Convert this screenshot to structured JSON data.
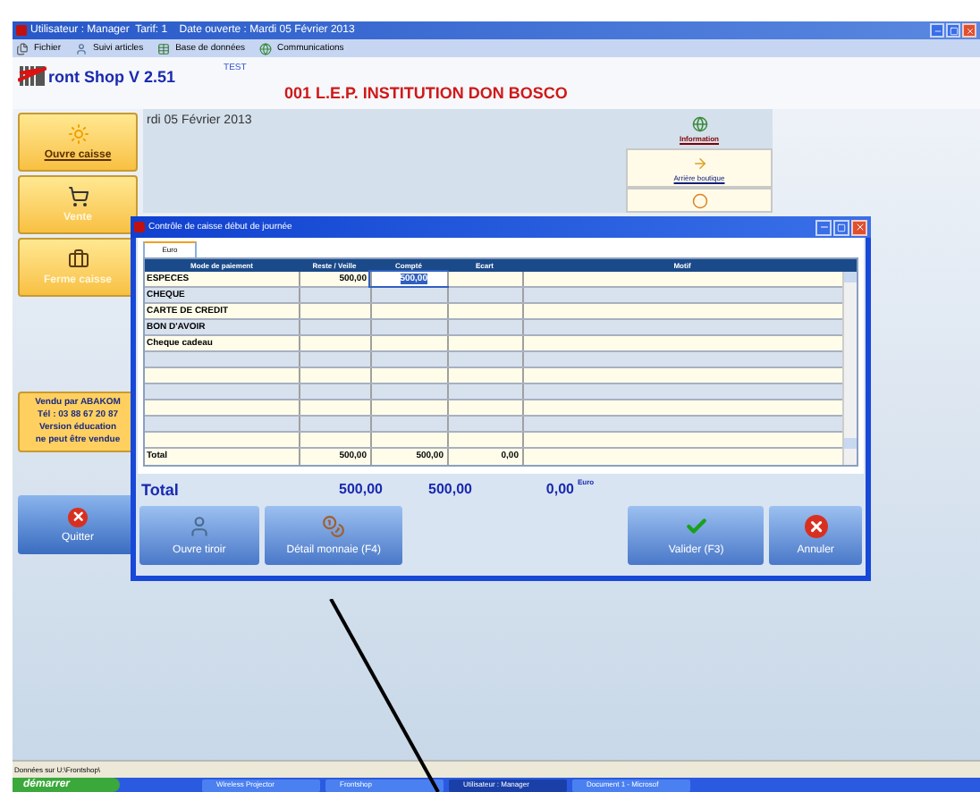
{
  "window": {
    "title": "Utilisateur : Manager  Tarif: 1    Date ouverte : Mardi 05 Février 2013"
  },
  "menu": [
    {
      "label": "Fichier"
    },
    {
      "label": "Suivi articles"
    },
    {
      "label": "Base de données"
    },
    {
      "label": "Communications"
    }
  ],
  "header": {
    "app_name": "ront Shop V 2.51",
    "tag": "TEST",
    "company": "001 L.E.P. INSTITUTION DON BOSCO"
  },
  "sidebar": [
    {
      "label": "Ouvre caisse",
      "disabled": false
    },
    {
      "label": "Vente",
      "disabled": true
    },
    {
      "label": "Ferme caisse",
      "disabled": true
    }
  ],
  "vendor_note": [
    "Vendu par ABAKOM",
    "Tél : 03 88 67 20 87",
    "Version éducation",
    "ne peut être vendue"
  ],
  "quit_button": {
    "label": "Quitter"
  },
  "main": {
    "date": "rdi 05 Février 2013",
    "shortcuts": [
      {
        "label": "Information"
      },
      {
        "label": "Arrière boutique"
      }
    ]
  },
  "dialog": {
    "title": "Contrôle de caisse début de journée",
    "tabs": [
      {
        "label": "Euro",
        "selected": true
      }
    ],
    "columns": [
      "Mode de paiement",
      "Reste / Veille",
      "Compté",
      "Ecart",
      "Motif"
    ],
    "rows": [
      {
        "mode": "ESPECES",
        "reste": "500,00",
        "compte": "500,00",
        "focused": true
      },
      {
        "mode": "CHEQUE",
        "focused": false
      },
      {
        "mode": "CARTE DE CREDIT",
        "focused": false
      },
      {
        "mode": "BON D'AVOIR",
        "focused": false
      },
      {
        "mode": "Cheque cadeau",
        "focused": false
      }
    ],
    "total_row": {
      "label": "Total",
      "reste": "500,00",
      "compte": "500,00",
      "ecart": "0,00"
    },
    "totals": {
      "label": "Total",
      "reste": "500,00",
      "compte": "500,00",
      "ecart": "0,00",
      "unit": "Euro"
    },
    "buttons": [
      {
        "label": "Ouvre tiroir"
      },
      {
        "label": "Détail monnaie (F4)"
      },
      {
        "label": "Valider (F3)"
      },
      {
        "label": "Annuler"
      }
    ]
  },
  "status_bar": "Données sur U:\\Frontshop\\",
  "taskbar": {
    "start": "démarrer",
    "tasks": [
      {
        "label": "Wireless Projector",
        "active": false
      },
      {
        "label": "Frontshop",
        "active": false
      },
      {
        "label": "Utilisateur : Manager",
        "active": true
      },
      {
        "label": "Document 1 - Microsof",
        "active": false
      }
    ]
  }
}
